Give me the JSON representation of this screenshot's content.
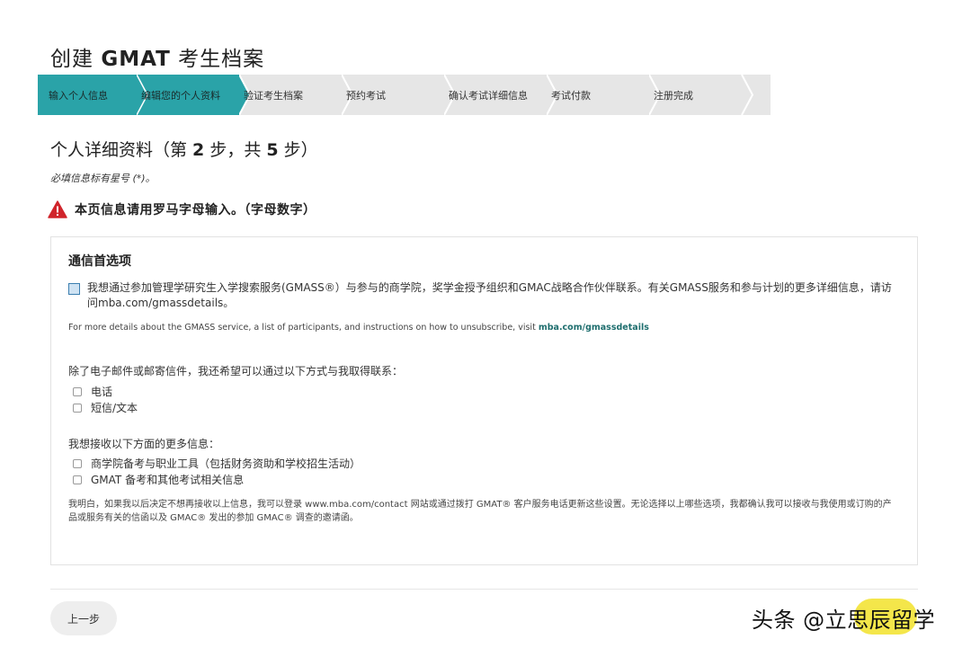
{
  "page": {
    "title_prefix": "创建 ",
    "title_bold": "GMAT",
    "title_suffix": " 考生档案"
  },
  "stepper": {
    "steps": [
      {
        "label": "输入个人信息",
        "state": "done"
      },
      {
        "label": "编辑您的个人资料",
        "state": "active"
      },
      {
        "label": "验证考生档案",
        "state": "todo"
      },
      {
        "label": "预约考试",
        "state": "todo"
      },
      {
        "label": "确认考试详细信息",
        "state": "todo"
      },
      {
        "label": "考试付款",
        "state": "todo"
      },
      {
        "label": "注册完成",
        "state": "todo"
      }
    ],
    "colors": {
      "active": "#2aa3a8",
      "inactive": "#e6e6e6",
      "separator": "#ffffff"
    }
  },
  "heading": {
    "prefix": "个人详细资料（第 ",
    "current": "2",
    "middle": " 步，共 ",
    "total": "5",
    "suffix": " 步）"
  },
  "required_note": "必填信息标有星号 (*)。",
  "warning": {
    "icon": "warning-triangle-icon",
    "color": "#d0242b",
    "text": "本页信息请用罗马字母输入。（字母数字）"
  },
  "panel": {
    "title": "通信首选项",
    "gmass_checkbox_text": "我想通过参加管理学研究生入学搜索服务(GMASS®）与参与的商学院，奖学金授予组织和GMAC战略合作伙伴联系。有关GMASS服务和参与计划的更多详细信息，请访问mba.com/gmassdetails。",
    "gmass_note_text": "For more details about the GMASS service, a list of participants, and instructions on how to unsubscribe, visit ",
    "gmass_note_link": "mba.com/gmassdetails",
    "contact_question": "除了电子邮件或邮寄信件，我还希望可以通过以下方式与我取得联系：",
    "contact_options": [
      "电话",
      "短信/文本"
    ],
    "info_question": "我想接收以下方面的更多信息：",
    "info_options": [
      "商学院备考与职业工具（包括财务资助和学校招生活动）",
      "GMAT 备考和其他考试相关信息"
    ],
    "disclaimer": "我明白，如果我以后决定不想再接收以上信息，我可以登录 www.mba.com/contact 网站或通过拨打 GMAT® 客户服务电话更新这些设置。无论选择以上哪些选项，我都确认我可以接收与我使用或订购的产品或服务有关的信函以及 GMAC® 发出的参加 GMAC® 调查的邀请函。"
  },
  "footer": {
    "back_label": "上一步"
  },
  "watermark": "头条 @立思辰留学"
}
